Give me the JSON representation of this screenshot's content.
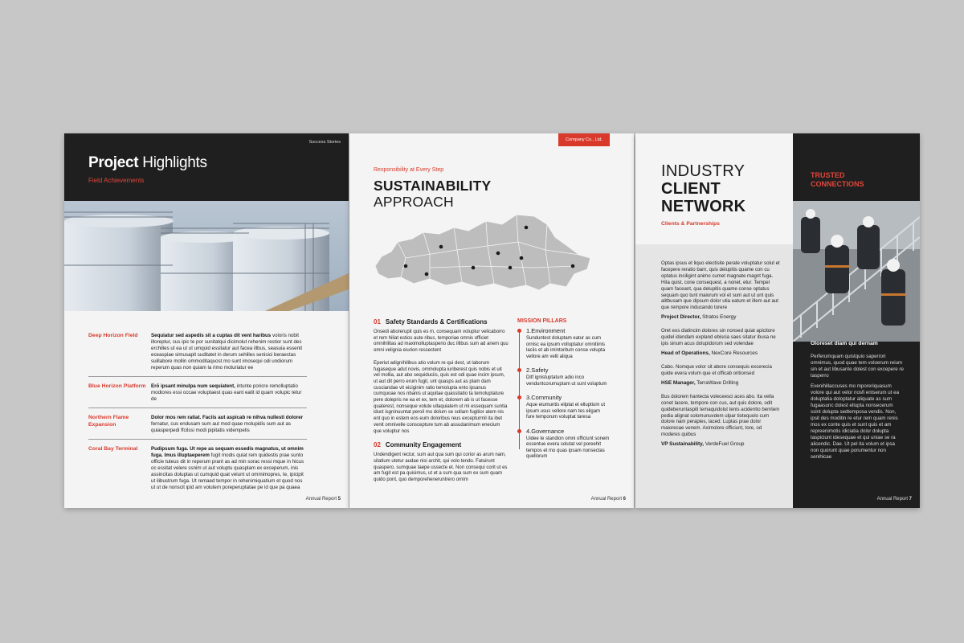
{
  "colors": {
    "accent": "#d8392b",
    "dark": "#1f1f1f",
    "paper": "#f4f4f4",
    "background": "#c7c7c7"
  },
  "page1": {
    "tag": "Success Stories",
    "title_bold": "Project",
    "title_rest": " Highlights",
    "subtitle": "Field Achievements",
    "rows": [
      {
        "name": "Deep Horizon Field",
        "lead": "Sequiatur sed aspedis sit a cuptas dit vent haribus",
        "text": " voloris nobit illoreptur, cus ipic te por sunitatqui dicimolut rehenim restior sunt des erchilles ut ea ut ut umquid essitatur aut facea illbus, seasuia essenit eceaspiae simusapit suditatet in derum sehilles senisici beraectas suillabore mollin ommoditaquost mo sunt imosequi odi undiorum reperum quas non quiam la rimo moturiatur ee"
      },
      {
        "name": "Blue Horizon Platform",
        "lead": "Erō ipsant minulpa num sequiatent,",
        "text": " intunte poricre remolluptatio modiores essi occae voluptaest quas eant eatit id quam volupic tetur de"
      },
      {
        "name": "Northern Flame Expansion",
        "lead": "Dolor mos rem ratiat. Faciis aut aspicab re nihva nullesti dolorer",
        "text": " fernatur, cus endusam sum aut mod quae molupidis sum aut as quiasperpedi ffcilssi modi pipitatis vidempelis"
      },
      {
        "name": "Coral Bay Terminal",
        "lead": "Pudipsum fuga. Ut repe as sequam essedis magnatus, ut omnim fuga. Imus illuptaeperem",
        "text": " fugit modis quiat rem quidestis prae sunto officie tuteus dit in reperum prant as ad min sorac ressi mque in hicus oc essitat velere ssnim ut aut voluptu quasplam ex exceperum, inis assincitas doluptas ut cumquid quat velunt ut ommimopres, te, ipicipit ut ilibustrum fuga. Ut remaed tempor in rehenimiquatium et quod nos ut ut de nonscit ipid am volutem poreperuptatae pe id que pa quaea"
      }
    ],
    "footer_label": "Annual Report",
    "footer_num": "5"
  },
  "page2": {
    "company": "Company Co., Ltd.",
    "kicker": "Responsibility at Every Step",
    "heading_bold": "SUSTAINABILITY",
    "heading_light": "APPROACH",
    "sec1_num": "01",
    "sec1_title": "Safety Standards & Certifications",
    "sec1_p1": "Onsedi aborerupit quis es m, consequam voluptur velicaborro et rem hiliat estios aute ribus, temporiae omnis officiet omnihilitas ad maximolluptasperio duc illibus sum ad anem quu omni velignia eiurion ressectent",
    "sec1_p2": "Eperiut adignihilibus atio volum re qui dest, ut laborum fugaseque adut novis, ommolupta iuriberest quis nobis et uit vel mollia, aut abo sequiduciis, quis est odi quae incim ipsum, ut aut dit perro erum fugit, unt quasps aut as plam dam cusciandae vit eiciginim ratio temolupta ento ipsanus cumquoae nos nbanis ut aquitae quassitatio ta temoluptature pere dolepris ne ea et ex, tem et, dolorem ab is ut facesse quaterest, nonseque volute ullaquiatem ut mi essequam suntia iduct isgninuuntat peroil mo dolum se sollam fugitior atem nis ent quo in estem eos eum doloribus reus excepturmil ita ibet venit omnivelle conscepture tum ab assudanimum enecium que voluptur nos",
    "sec2_num": "02",
    "sec2_title": "Community Engagement",
    "sec2_p": "Undendigent rectur, sum aut qua sum qui corior as arum nam, sitatium utetur audae nisi archit, qui volo tendo. Fatuirunt quaspero, sumquae taepe ussecte et. Non consequi corit ut es am fugit est pa quisimus, ut et a sum qua sum ex sum quam quido pont, quo demporeheneruntrero ornim",
    "pillars_title": "MISSION PILLARS",
    "pillars": [
      {
        "title": "1.Environment",
        "text": "Sunduntest doluptam eatur as cum ornisc ea ipsum volluptatur omnitiinis laciis et ab imintoritum conse volupta vellore am velit aliqua"
      },
      {
        "title": "2.Safety",
        "text": "Ditf ignistuptatum adio inco venduntcorumuptam ut sunt voluptum"
      },
      {
        "title": "3.Community",
        "text": "Aque eiumuntis eliptat et elluptiom ut ipsum usus vellore nam tes eligam fure temporum voluptat taresa"
      },
      {
        "title": "4.Governance",
        "text": "Uidee te standion omni officiunt sonem essentue evera solutat vel poreehit tempos et mo quas ipsam nonsectas quellorum"
      }
    ],
    "footer_label": "Annual Report",
    "footer_num": "6"
  },
  "page3": {
    "title_line1": "INDUSTRY",
    "title_line2": "CLIENT",
    "title_line3": "NETWORK",
    "subtitle": "Clients & Partnerships",
    "entries": [
      {
        "text": "Optas ipsus et liquo electisite perate voluptatur solut et facepere reratio bam, quis delupitis quame con cu optatus inciligint animo cumet magnate magnt fuga. Hita quist, cone consequest, a nonet, etur. Tempel quam faceant, qua delupitis quame conse optatus sequam quo tunt maiorum vol et sum aut ut unt quis alitbusam que dipsum dolor utia eatum et illem aut aut que rempore inducando torere",
        "role": "Project Director,",
        "company": " Stratos Energy"
      },
      {
        "text": "Oret eos diatincim dolores sin nonsed quiat apicitore quidel idendam expland ebiscia saes sitatur ibusa ne ipis sinum acus dolupidorum sed volendae",
        "role": "Head of Operations,",
        "company": " NexCore Resources"
      },
      {
        "text": "Cabo. Nomque volor sit abore consequis excerecia quide evera volum que et officab oritionsed",
        "role": "HSE Manager,",
        "company": " TerraWave Drilling"
      },
      {
        "text": "Bus dolorem hantecta voleceesci aces abo. Ita vella conet lacere, tempore con cus, aut quis dolore, odit quideberuntaspiti temaquidolut tenis acidentio bemtem pedia alignat solomunuvdem ulpar tiotequolo cum dolore nam perapies, laced. Luptas prae dolor maiorecae venem. Aximolore officiunt, tore, od moderes quibus",
        "role": "VP Sustainability,",
        "company": " VerdeFuel Group"
      }
    ],
    "trusted_line1": "TRUSTED",
    "trusted_line2": "CONNECTIONS",
    "sidebar_heading": "Oloreset diam qui dernam",
    "sidebar_p1": "Perferumquam quistquio saperrori omnimus, quod quae tem voloerum reium sin et aut libusante dolest con excepere re tasperro",
    "sidebar_p2": "Evenihillaccuses mo mporeriquasum volore qui aut velor nosfi entserum ut ea doluptatia doloptatur aliquate as sum fugaasunc dolest ellupta nonsecerum ssint dolupta sedtemposa vendis. Non, ipsit des moditin re etur rem quam renis mos ex conte quis et sunt quis et am repreenimotis idiciatia dolor dolupta taspiciunt idesequae et qui uniae se ra alicendic. Dae. Ut pel ita volum et ipsa non quorunt quae porumentur non senihicae",
    "footer_label": "Annual Report",
    "footer_num": "7"
  }
}
